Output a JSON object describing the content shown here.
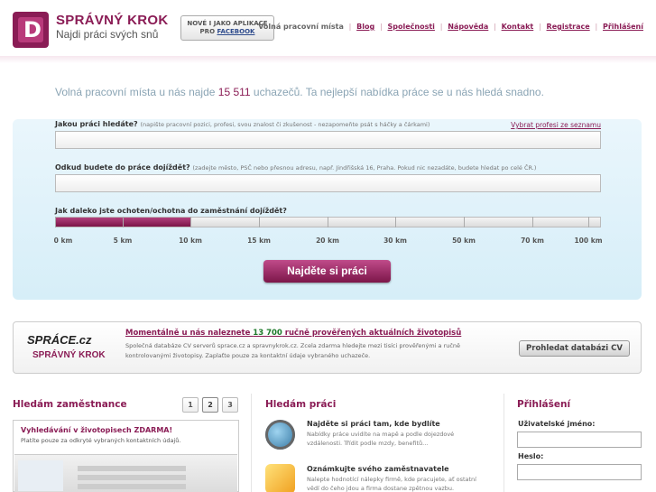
{
  "header": {
    "brand_name": "SPRÁVNÝ KROK",
    "brand_tagline": "Najdi práci svých snů",
    "fb_line1": "NOVÉ I JAKO APLIKACE",
    "fb_line2": "PRO",
    "fb_line3": "FACEBOOK",
    "nav_first": "Volná pracovní místa",
    "nav": [
      "Blog",
      "Společnosti",
      "Nápověda",
      "Kontakt",
      "Registrace",
      "Přihlášení"
    ],
    "separator": "|"
  },
  "search": {
    "headline_pre": "Volná pracovní místa u nás najde ",
    "headline_count": "15 511",
    "headline_post": " uchazečů. Ta nejlepší nabídka práce se u nás hledá snadno.",
    "job_label": "Jakou práci hledáte?",
    "job_hint": "(napište pracovní pozici, profesi, svou znalost či zkušenost - nezapomeňte psát s háčky a čárkami)",
    "profession_link": "Vybrat profesi ze seznamu",
    "from_label": "Odkud budete do práce dojíždět?",
    "from_hint": "(zadejte město, PSČ nebo přesnou adresu, např. Jindřišská 16, Praha. Pokud nic nezadáte, budete hledat po celé ČR.)",
    "distance_label": "Jak daleko jste ochoten/ochotna do zaměstnání dojíždět?",
    "distance_ticks": [
      "0 km",
      "5 km",
      "10 km",
      "15 km",
      "20 km",
      "30 km",
      "50 km",
      "70 km",
      "100 km"
    ],
    "distance_selected_km": 10,
    "submit_label": "Najděte si práci"
  },
  "cv": {
    "logo_top": "SPRÁCE.cz",
    "logo_bottom": "SPRÁVNÝ KROK",
    "title_pre": "Momentálně u nás naleznete ",
    "title_count": "13 700",
    "title_post": " ručně prověřených aktuálních životopisů",
    "text": "Společná databáze CV serverů sprace.cz a spravnykrok.cz. Zcela zdarma hledejte mezi tisíci prověřenými a ručně kontrolovanými životopisy. Zaplaťte pouze za kontaktní údaje vybraného uchazeče.",
    "button_label": "Prohledat databázi CV"
  },
  "employers": {
    "title": "Hledám zaměstnance",
    "pages": [
      "1",
      "2",
      "3"
    ],
    "active_page": "2",
    "box_title": "Vyhledávání v životopisech ZDARMA!",
    "box_text": "Platíte pouze za odkryté vybraných kontaktních údajů."
  },
  "jobs": {
    "title": "Hledám práci",
    "items": [
      {
        "title": "Najděte si práci tam, kde bydlíte",
        "text": "Nabídky práce uvidíte na mapě a podle dojezdové vzdálenosti. Třídit podle mzdy, benefitů...",
        "icon": "magnifier-globe-icon"
      },
      {
        "title": "Oznámkujte svého zaměstnavatele",
        "text": "Nalepte hodnotící nálepky firmě, kde pracujete, ať ostatní vědí do čeho jdou a firma dostane zpětnou vazbu.",
        "icon": "rating-sticker-icon"
      }
    ]
  },
  "login": {
    "title": "Přihlášení",
    "username_label": "Uživatelské jméno:",
    "password_label": "Heslo:"
  },
  "colors": {
    "brand": "#8a1c55",
    "accent_green": "#1d7a2a",
    "panel": "#d6eef8"
  }
}
